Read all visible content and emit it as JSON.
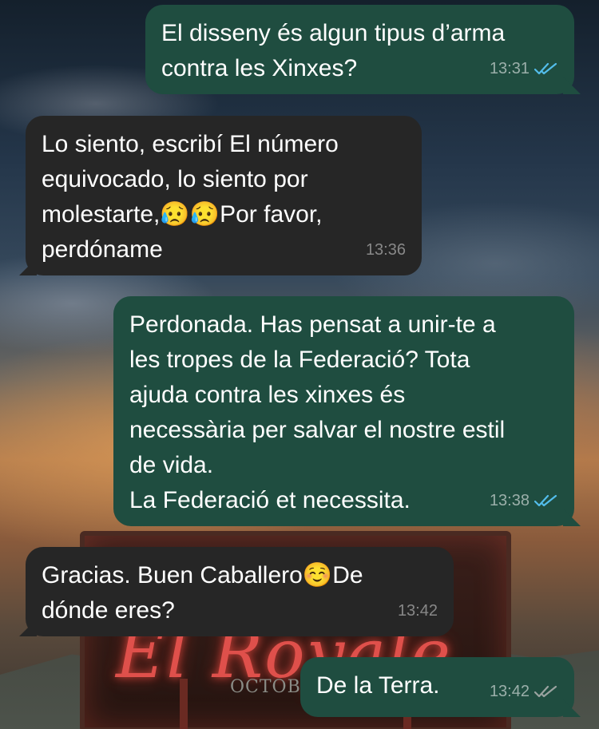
{
  "messages": [
    {
      "id": "m1",
      "direction": "outgoing",
      "text": "El disseny és algun tipus d’arma\ncontra les Xinxes?",
      "time": "13:31",
      "status": "read",
      "status_color": "#53bdeb"
    },
    {
      "id": "m2",
      "direction": "incoming",
      "text": "Lo siento, escribí El número\nequivocado, lo siento por\nmolestarte,😥😥Por favor,\nperdóname",
      "time": "13:36"
    },
    {
      "id": "m3",
      "direction": "outgoing",
      "text": "Perdonada. Has pensat a unir-te a\nles tropes de la Federació? Tota\najuda contra les xinxes és\nnecessària per salvar el nostre estil\nde vida.\nLa Federació et necessita.",
      "time": "13:38",
      "status": "read",
      "status_color": "#53bdeb"
    },
    {
      "id": "m4",
      "direction": "incoming",
      "text": "Gracias. Buen Caballero☺️De\ndónde eres?",
      "time": "13:42"
    },
    {
      "id": "m5",
      "direction": "outgoing",
      "text": "De la Terra.",
      "time": "13:42",
      "status": "delivered",
      "status_color": "#9aa3a0"
    }
  ],
  "colors": {
    "incoming_bubble": "#262626",
    "outgoing_bubble": "#1f4d40",
    "read_ticks": "#53bdeb",
    "delivered_ticks": "#9aa3a0"
  },
  "wallpaper": {
    "sign_text": "El Royale",
    "sign_subtext": "OCTOBER"
  }
}
